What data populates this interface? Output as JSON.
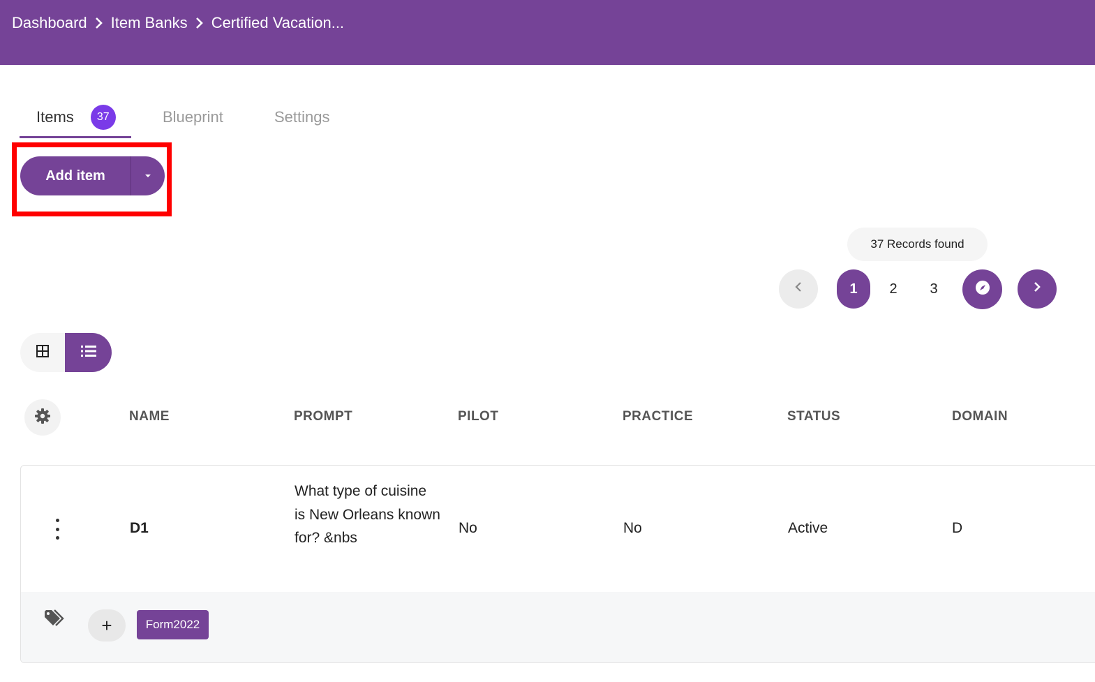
{
  "breadcrumb": {
    "items": [
      "Dashboard",
      "Item Banks",
      "Certified Vacation..."
    ]
  },
  "tabs": [
    {
      "label": "Items",
      "badge": "37",
      "active": true
    },
    {
      "label": "Blueprint",
      "active": false
    },
    {
      "label": "Settings",
      "active": false
    }
  ],
  "toolbar": {
    "add_item_label": "Add item"
  },
  "records": {
    "text": "37 Records found"
  },
  "pagination": {
    "pages": [
      "1",
      "2",
      "3"
    ],
    "current": "1"
  },
  "table": {
    "columns": [
      "NAME",
      "PROMPT",
      "PILOT",
      "PRACTICE",
      "STATUS",
      "DOMAIN"
    ],
    "rows": [
      {
        "name": "D1",
        "prompt": "What type of cuisine is New Orleans known for? &nbs",
        "pilot": "No",
        "practice": "No",
        "status": "Active",
        "domain": "D",
        "tags": [
          "Form2022"
        ],
        "add_tag_label": "+"
      }
    ]
  },
  "colors": {
    "brand": "#754397",
    "badge": "#7a3be8",
    "highlight": "#ff0000"
  },
  "icons": [
    "chevron-right-icon",
    "caret-down-icon",
    "chevron-left-icon",
    "compass-icon",
    "grid-view-icon",
    "list-view-icon",
    "gear-icon",
    "kebab-menu-icon",
    "tags-icon"
  ]
}
